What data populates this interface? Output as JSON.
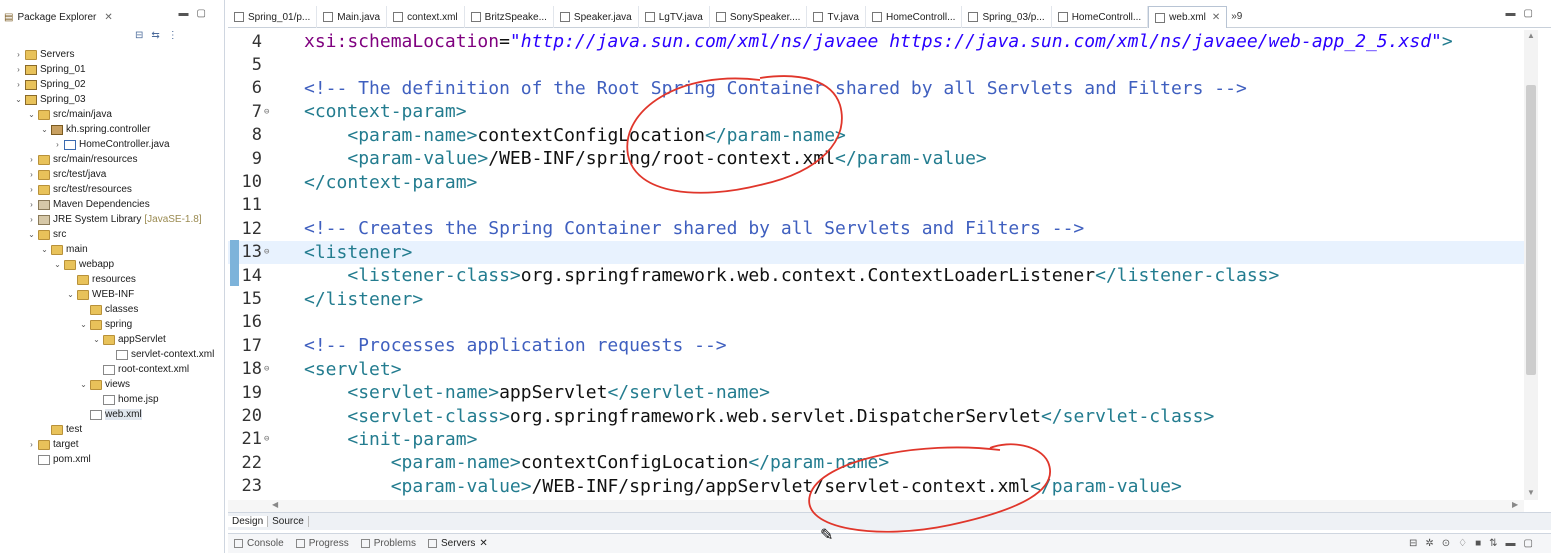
{
  "package_explorer": {
    "title": "Package Explorer",
    "tree": [
      {
        "label": "Servers",
        "twisty": "›",
        "icon": "folder",
        "indent": 0
      },
      {
        "label": "Spring_01",
        "twisty": "›",
        "icon": "proj",
        "indent": 0
      },
      {
        "label": "Spring_02",
        "twisty": "›",
        "icon": "proj",
        "indent": 0
      },
      {
        "label": "Spring_03",
        "twisty": "⌄",
        "icon": "proj",
        "indent": 0
      },
      {
        "label": "src/main/java",
        "twisty": "⌄",
        "icon": "folder",
        "indent": 1
      },
      {
        "label": "kh.spring.controller",
        "twisty": "⌄",
        "icon": "pkg",
        "indent": 2
      },
      {
        "label": "HomeController.java",
        "twisty": "›",
        "icon": "java",
        "indent": 3
      },
      {
        "label": "src/main/resources",
        "twisty": "›",
        "icon": "folder",
        "indent": 1
      },
      {
        "label": "src/test/java",
        "twisty": "›",
        "icon": "folder",
        "indent": 1
      },
      {
        "label": "src/test/resources",
        "twisty": "›",
        "icon": "folder",
        "indent": 1
      },
      {
        "label": "Maven Dependencies",
        "twisty": "›",
        "icon": "lib",
        "indent": 1
      },
      {
        "label": "JRE System Library",
        "sub": "[JavaSE-1.8]",
        "twisty": "›",
        "icon": "lib",
        "indent": 1
      },
      {
        "label": "src",
        "twisty": "⌄",
        "icon": "folder",
        "indent": 1
      },
      {
        "label": "main",
        "twisty": "⌄",
        "icon": "folder",
        "indent": 2
      },
      {
        "label": "webapp",
        "twisty": "⌄",
        "icon": "folder",
        "indent": 3
      },
      {
        "label": "resources",
        "twisty": "",
        "icon": "folder",
        "indent": 4
      },
      {
        "label": "WEB-INF",
        "twisty": "⌄",
        "icon": "folder",
        "indent": 4
      },
      {
        "label": "classes",
        "twisty": "",
        "icon": "folder",
        "indent": 5
      },
      {
        "label": "spring",
        "twisty": "⌄",
        "icon": "folder",
        "indent": 5
      },
      {
        "label": "appServlet",
        "twisty": "⌄",
        "icon": "folder",
        "indent": 6
      },
      {
        "label": "servlet-context.xml",
        "twisty": "",
        "icon": "xml",
        "indent": 7
      },
      {
        "label": "root-context.xml",
        "twisty": "",
        "icon": "xml",
        "indent": 6
      },
      {
        "label": "views",
        "twisty": "⌄",
        "icon": "folder",
        "indent": 5
      },
      {
        "label": "home.jsp",
        "twisty": "",
        "icon": "xml",
        "indent": 6
      },
      {
        "label": "web.xml",
        "twisty": "",
        "icon": "xml",
        "indent": 5,
        "selected": true
      },
      {
        "label": "test",
        "twisty": "",
        "icon": "folder",
        "indent": 2
      },
      {
        "label": "target",
        "twisty": "›",
        "icon": "folder",
        "indent": 1
      },
      {
        "label": "pom.xml",
        "twisty": "",
        "icon": "xml",
        "indent": 1
      }
    ]
  },
  "editor_tabs": [
    {
      "label": "Spring_01/p...",
      "active": false
    },
    {
      "label": "Main.java",
      "active": false
    },
    {
      "label": "context.xml",
      "active": false
    },
    {
      "label": "BritzSpeake...",
      "active": false
    },
    {
      "label": "Speaker.java",
      "active": false
    },
    {
      "label": "LgTV.java",
      "active": false
    },
    {
      "label": "SonySpeaker....",
      "active": false
    },
    {
      "label": "Tv.java",
      "active": false
    },
    {
      "label": "HomeControll...",
      "active": false
    },
    {
      "label": "Spring_03/p...",
      "active": false
    },
    {
      "label": "HomeControll...",
      "active": false
    },
    {
      "label": "web.xml",
      "active": true
    }
  ],
  "overflow_label": "»9",
  "code_lines": [
    {
      "n": "4",
      "fold": "",
      "cur": false,
      "parts": [
        [
          "attr",
          "xsi:schemaLocation"
        ],
        [
          "txtc",
          "="
        ],
        [
          "val",
          "\"http://java.sun.com/xml/ns/javaee https://java.sun.com/xml/ns/javaee/web-app_2_5.xsd\""
        ],
        [
          "tag",
          ">"
        ]
      ]
    },
    {
      "n": "5",
      "fold": "",
      "cur": false,
      "parts": []
    },
    {
      "n": "6",
      "fold": "",
      "cur": false,
      "parts": [
        [
          "cm",
          "<!-- The definition of the Root Spring Container shared by all Servlets and Filters -->"
        ]
      ]
    },
    {
      "n": "7",
      "fold": "⊖",
      "cur": false,
      "parts": [
        [
          "tag",
          "<context-param>"
        ]
      ]
    },
    {
      "n": "8",
      "fold": "",
      "cur": false,
      "parts": [
        [
          "txtc",
          "    "
        ],
        [
          "tag",
          "<param-name>"
        ],
        [
          "txtc",
          "contextConfigLocation"
        ],
        [
          "tag",
          "</param-name>"
        ]
      ]
    },
    {
      "n": "9",
      "fold": "",
      "cur": false,
      "parts": [
        [
          "txtc",
          "    "
        ],
        [
          "tag",
          "<param-value>"
        ],
        [
          "txtc",
          "/WEB-INF/spring/root-context.xml"
        ],
        [
          "tag",
          "</param-value>"
        ]
      ]
    },
    {
      "n": "10",
      "fold": "",
      "cur": false,
      "parts": [
        [
          "tag",
          "</context-param>"
        ]
      ]
    },
    {
      "n": "11",
      "fold": "",
      "cur": false,
      "parts": []
    },
    {
      "n": "12",
      "fold": "",
      "cur": false,
      "parts": [
        [
          "cm",
          "<!-- Creates the Spring Container shared by all Servlets and Filters -->"
        ]
      ]
    },
    {
      "n": "13",
      "fold": "⊖",
      "cur": true,
      "parts": [
        [
          "tag",
          "<listener>"
        ]
      ]
    },
    {
      "n": "14",
      "fold": "",
      "cur": false,
      "parts": [
        [
          "txtc",
          "    "
        ],
        [
          "tag",
          "<listener-class>"
        ],
        [
          "txtc",
          "org.springframework.web.context.ContextLoaderListener"
        ],
        [
          "tag",
          "</listener-class>"
        ]
      ]
    },
    {
      "n": "15",
      "fold": "",
      "cur": false,
      "parts": [
        [
          "tag",
          "</listener>"
        ]
      ]
    },
    {
      "n": "16",
      "fold": "",
      "cur": false,
      "parts": []
    },
    {
      "n": "17",
      "fold": "",
      "cur": false,
      "parts": [
        [
          "cm",
          "<!-- Processes application requests -->"
        ]
      ]
    },
    {
      "n": "18",
      "fold": "⊖",
      "cur": false,
      "parts": [
        [
          "tag",
          "<servlet>"
        ]
      ]
    },
    {
      "n": "19",
      "fold": "",
      "cur": false,
      "parts": [
        [
          "txtc",
          "    "
        ],
        [
          "tag",
          "<servlet-name>"
        ],
        [
          "txtc",
          "appServlet"
        ],
        [
          "tag",
          "</servlet-name>"
        ]
      ]
    },
    {
      "n": "20",
      "fold": "",
      "cur": false,
      "parts": [
        [
          "txtc",
          "    "
        ],
        [
          "tag",
          "<servlet-class>"
        ],
        [
          "txtc",
          "org.springframework.web.servlet.DispatcherServlet"
        ],
        [
          "tag",
          "</servlet-class>"
        ]
      ]
    },
    {
      "n": "21",
      "fold": "⊖",
      "cur": false,
      "parts": [
        [
          "txtc",
          "    "
        ],
        [
          "tag",
          "<init-param>"
        ]
      ]
    },
    {
      "n": "22",
      "fold": "",
      "cur": false,
      "parts": [
        [
          "txtc",
          "        "
        ],
        [
          "tag",
          "<param-name>"
        ],
        [
          "txtc",
          "contextConfigLocation"
        ],
        [
          "tag",
          "</param-name>"
        ]
      ]
    },
    {
      "n": "23",
      "fold": "",
      "cur": false,
      "parts": [
        [
          "txtc",
          "        "
        ],
        [
          "tag",
          "<param-value>"
        ],
        [
          "txtc",
          "/WEB-INF/spring/appServlet/servlet-context.xml"
        ],
        [
          "tag",
          "</param-value>"
        ]
      ]
    }
  ],
  "editor_bottom_tabs": [
    {
      "label": "Design",
      "active": true
    },
    {
      "label": "Source",
      "active": false
    }
  ],
  "console_tabs": [
    {
      "label": "Console",
      "active": false
    },
    {
      "label": "Progress",
      "active": false
    },
    {
      "label": "Problems",
      "active": false
    },
    {
      "label": "Servers",
      "active": true
    }
  ],
  "colors": {
    "tag": "#237c8f",
    "comment": "#3f5fbf",
    "attr": "#7f007f",
    "value": "#2a00ff",
    "annotation": "#e0362b"
  }
}
